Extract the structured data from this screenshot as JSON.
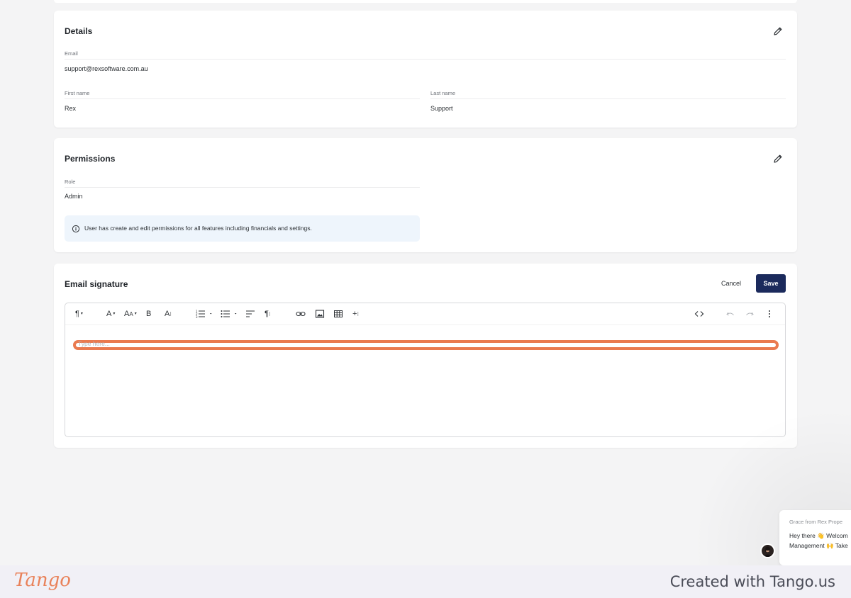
{
  "details": {
    "title": "Details",
    "email_label": "Email",
    "email_value": "support@rexsoftware.com.au",
    "first_name_label": "First name",
    "first_name_value": "Rex",
    "last_name_label": "Last name",
    "last_name_value": "Support"
  },
  "permissions": {
    "title": "Permissions",
    "role_label": "Role",
    "role_value": "Admin",
    "info_text": "User has create and edit permissions for all features including financials and settings."
  },
  "signature": {
    "title": "Email signature",
    "cancel_label": "Cancel",
    "save_label": "Save",
    "placeholder": "Type here..."
  },
  "toolbar": {
    "items": [
      "paragraph-format-icon",
      "font-color-icon",
      "font-size-icon",
      "bold-icon",
      "more-text-icon",
      "ordered-list-icon",
      "unordered-list-icon",
      "align-icon",
      "more-paragraph-icon",
      "link-icon",
      "image-icon",
      "table-icon",
      "more-insert-icon",
      "code-view-icon",
      "undo-icon",
      "redo-icon",
      "more-options-icon"
    ]
  },
  "chat": {
    "from": "Grace from Rex Prope",
    "message_line1": "Hey there 👋 Welcom",
    "message_line2": "Management 🙌 Take"
  },
  "footer": {
    "logo": "Tango",
    "created_text": "Created with Tango.us"
  },
  "colors": {
    "save_button": "#1b2a5c",
    "highlight": "#ea7a4f",
    "info_bg": "#eef5fc",
    "tango_orange": "#e9825a"
  }
}
